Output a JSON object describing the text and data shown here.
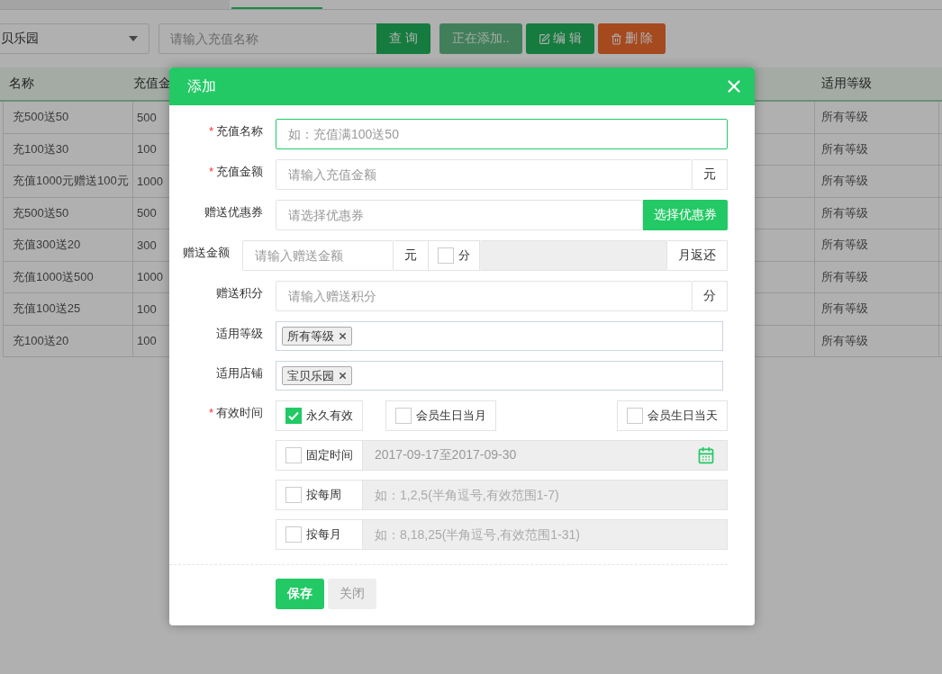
{
  "toolbar": {
    "store_select": {
      "value": "贝乐园"
    },
    "search": {
      "placeholder": "请输入充值名称"
    },
    "buttons": [
      {
        "label": "查 询",
        "kind": "query",
        "disabled": false
      },
      {
        "label": "正在添加..",
        "kind": "add",
        "disabled": true
      },
      {
        "label": "编 辑",
        "kind": "edit",
        "disabled": false
      },
      {
        "label": "删 除",
        "kind": "delete",
        "disabled": false
      }
    ]
  },
  "table": {
    "columns": [
      "名称",
      "充值金",
      "适用等级"
    ],
    "rows": [
      {
        "name": "充500送50",
        "amount": "500",
        "level": "所有等级"
      },
      {
        "name": "充100送30",
        "amount": "100",
        "level": "所有等级"
      },
      {
        "name": "充值1000元赠送100元",
        "amount": "1000",
        "level": "所有等级"
      },
      {
        "name": "充500送50",
        "amount": "500",
        "level": "所有等级"
      },
      {
        "name": "充值300送20",
        "amount": "300",
        "level": "所有等级"
      },
      {
        "name": "充值1000送500",
        "amount": "1000",
        "level": "所有等级"
      },
      {
        "name": "充值100送25",
        "amount": "100",
        "level": "所有等级"
      },
      {
        "name": "充100送20",
        "amount": "100",
        "level": "所有等级"
      }
    ]
  },
  "dialog": {
    "title": "添加",
    "fields": [
      {
        "kind": "text",
        "label": "充值名称",
        "required_mark": "*",
        "placeholder": "如：充值满100送50",
        "focused": true
      },
      {
        "kind": "addon",
        "label": "充值金额",
        "required_mark": "*",
        "placeholder": "请输入充值金额",
        "suffix": "元"
      },
      {
        "kind": "picker",
        "label": "赠送优惠券",
        "placeholder": "请选择优惠券",
        "button": "选择优惠券"
      },
      {
        "kind": "gift",
        "label": "赠送金额",
        "placeholder": "请输入赠送金额",
        "unit": "元",
        "check_label": "分",
        "checked": false,
        "suffix": "月返还"
      },
      {
        "kind": "addon",
        "label": "赠送积分",
        "placeholder": "请输入赠送积分",
        "suffix": "分"
      },
      {
        "kind": "tags",
        "label": "适用等级",
        "tags": [
          "所有等级"
        ]
      },
      {
        "kind": "tags",
        "label": "适用店铺",
        "tags": [
          "宝贝乐园"
        ]
      },
      {
        "kind": "validity",
        "label": "有效时间",
        "required_mark": "*",
        "options": [
          {
            "label": "永久有效",
            "checked": true
          },
          {
            "label": "会员生日当月",
            "checked": false
          },
          {
            "label": "会员生日当天",
            "checked": false
          }
        ],
        "rows": [
          {
            "kind": "date",
            "label": "固定时间",
            "checked": false,
            "value": "2017-09-17至2017-09-30"
          },
          {
            "kind": "text",
            "label": "按每周",
            "checked": false,
            "placeholder": "如：1,2,5(半角逗号,有效范围1-7)"
          },
          {
            "kind": "text",
            "label": "按每月",
            "checked": false,
            "placeholder": "如：8,18,25(半角逗号,有效范围1-31)"
          }
        ]
      }
    ],
    "buttons": [
      {
        "label": "保存",
        "kind": "primary"
      },
      {
        "label": "关闭",
        "kind": "default"
      }
    ]
  }
}
